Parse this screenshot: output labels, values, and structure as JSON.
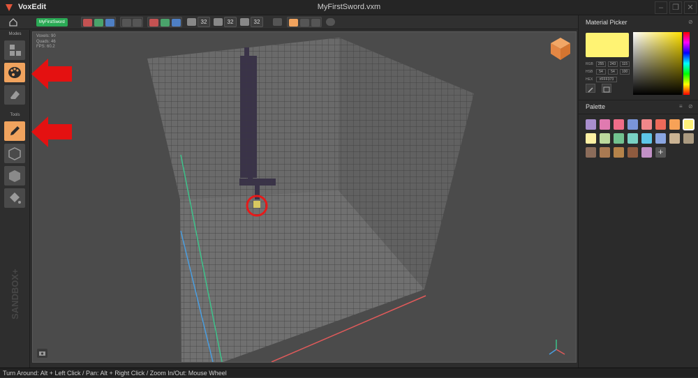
{
  "app": {
    "name": "VoxEdit",
    "document_title": "MyFirstSword.vxm"
  },
  "toolbar": {
    "project_badge": "MyFirstSword",
    "dim_x": "32",
    "dim_y": "32",
    "dim_z": "32"
  },
  "left_panel": {
    "modes_label": "Modes",
    "tools_label": "Tools",
    "brand_text": "SANDBOX+"
  },
  "viewport": {
    "stats": {
      "voxels": "Voxels: 90",
      "quads": "Quads: 46",
      "fps": "FPS: 60.2"
    }
  },
  "material_picker": {
    "title": "Material Picker",
    "current_color": "#FFF373",
    "rgb_label": "RGB",
    "rgb": [
      "255",
      "243",
      "115"
    ],
    "hsb_label": "HSB",
    "hsb": [
      "54",
      "54",
      "100"
    ],
    "hex_label": "HEX",
    "hex": "#FFF373"
  },
  "palette": {
    "title": "Palette",
    "colors": [
      "#a98ecd",
      "#e07ab0",
      "#ef6d88",
      "#7a95d8",
      "#f0878a",
      "#ee6a5a",
      "#f7a257",
      "#fdf07a",
      "#fdf0a4",
      "#bcd99c",
      "#72c28f",
      "#79d1c3",
      "#5dc6e8",
      "#8aa5e1",
      "#cab394",
      "#ab9a80",
      "#8b6c5a",
      "#a97a52",
      "#b5834a",
      "#8f5b3f",
      "#c291c6"
    ],
    "selected_index": 7,
    "add_label": "+"
  },
  "statusbar": {
    "text": "Turn Around: Alt + Left Click / Pan: Alt + Right Click / Zoom In/Out: Mouse Wheel"
  }
}
